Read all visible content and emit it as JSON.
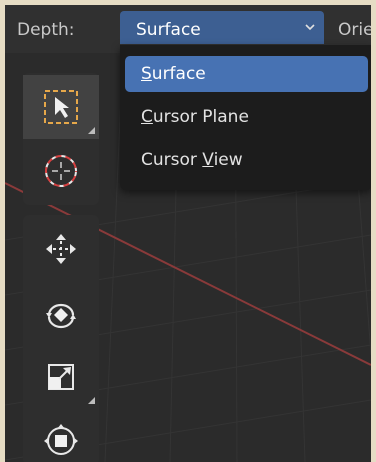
{
  "header": {
    "depth_label": "Depth:",
    "depth_value": "Surface",
    "orientation_label_partial": "Orie"
  },
  "dropdown": {
    "items": [
      {
        "before": "",
        "key": "S",
        "after": "urface",
        "selected": true
      },
      {
        "before": "",
        "key": "C",
        "after": "ursor Plane",
        "selected": false
      },
      {
        "before": "Cursor ",
        "key": "V",
        "after": "iew",
        "selected": false
      }
    ]
  },
  "toolbar": {
    "tools": [
      {
        "icon": "select-box-icon",
        "selected": true
      },
      {
        "icon": "cursor-icon",
        "selected": false
      },
      {
        "icon": "move-icon",
        "selected": false
      },
      {
        "icon": "rotate-icon",
        "selected": false
      },
      {
        "icon": "scale-icon",
        "selected": false
      },
      {
        "icon": "transform-icon",
        "selected": false
      }
    ]
  },
  "colors": {
    "accent": "#4772b3",
    "select_field": "#3d5f92",
    "viewport_bg": "#2b2b2b",
    "axis_red": "#8a3a3a",
    "border": "#e6dcc4"
  }
}
